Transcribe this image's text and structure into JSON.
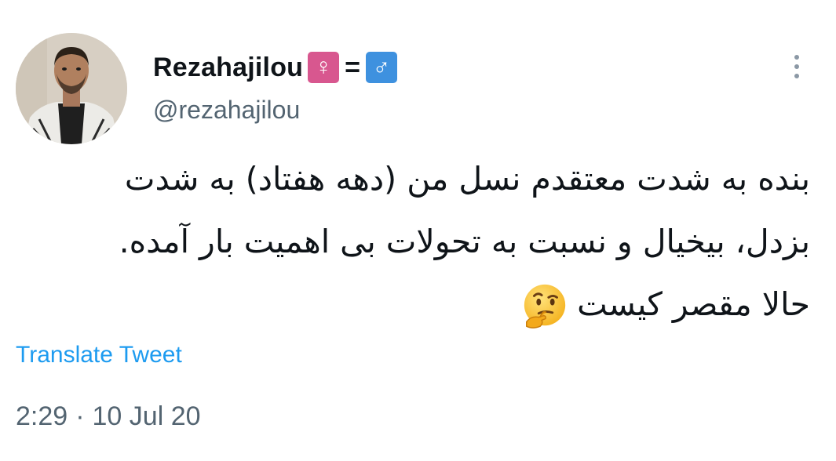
{
  "author": {
    "display_name": "Rezahajilou",
    "badge_female": "♀",
    "badge_equals": "=",
    "badge_male": "♂",
    "handle": "@rezahajilou",
    "avatar_icon": "profile-photo"
  },
  "more_icon": "more-vertical-icon",
  "tweet": {
    "lines": [
      "بنده به شدت معتقدم نسل من (دهه هفتاد) به شدت",
      "بزدل، بیخیال و نسبت به تحولات بی اهمیت بار آمده.",
      "حالا مقصر کیست"
    ],
    "emoji": "thinking-face-icon"
  },
  "translate_label": "Translate Tweet",
  "timestamp": {
    "time": "2:29",
    "separator": "·",
    "date": "10 Jul 20"
  },
  "colors": {
    "link": "#1d9bf0",
    "secondary_text": "#536471",
    "badge_female": "#d8578f",
    "badge_male": "#3e91df"
  }
}
